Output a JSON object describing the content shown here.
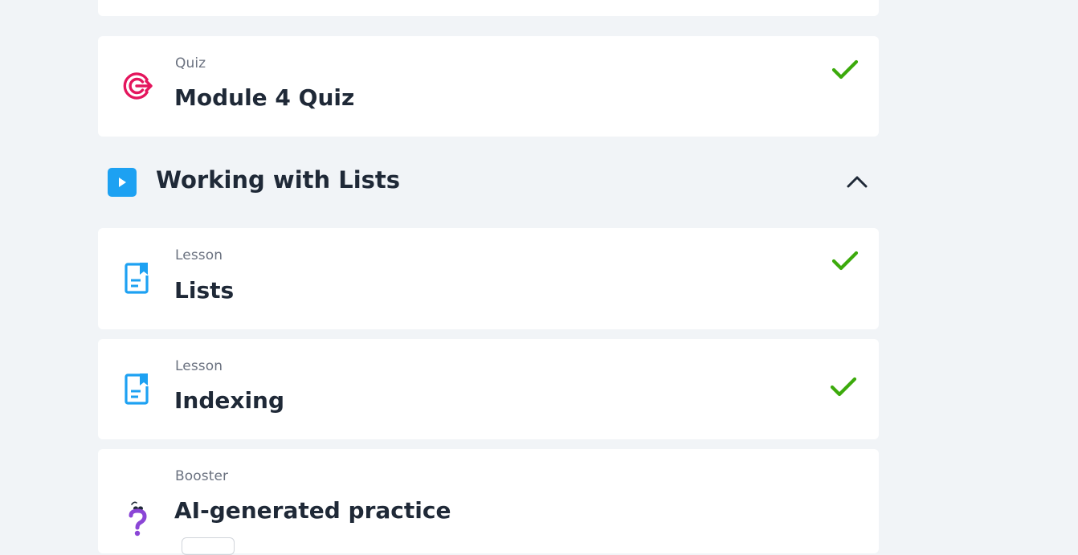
{
  "items": {
    "quiz": {
      "kind": "Quiz",
      "title": "Module 4 Quiz",
      "icon": "target-icon",
      "completed": true
    },
    "lists": {
      "kind": "Lesson",
      "title": "Lists",
      "icon": "lesson-document-icon",
      "completed": true
    },
    "indexing": {
      "kind": "Lesson",
      "title": "Indexing",
      "icon": "lesson-document-icon",
      "completed": true
    },
    "booster": {
      "kind": "Booster",
      "title": "AI-generated practice",
      "icon": "question-mark-icon",
      "completed": false
    }
  },
  "section": {
    "title": "Working with Lists",
    "icon": "play-icon",
    "expanded": true
  },
  "colors": {
    "background": "#f1f4f7",
    "card": "#ffffff",
    "check": "#3caa0c",
    "accent_blue": "#1da1f2",
    "quiz_red": "#e4165d",
    "booster_purple": "#8b46d6",
    "text_dark": "#1f2937",
    "text_muted": "#6b7280"
  }
}
